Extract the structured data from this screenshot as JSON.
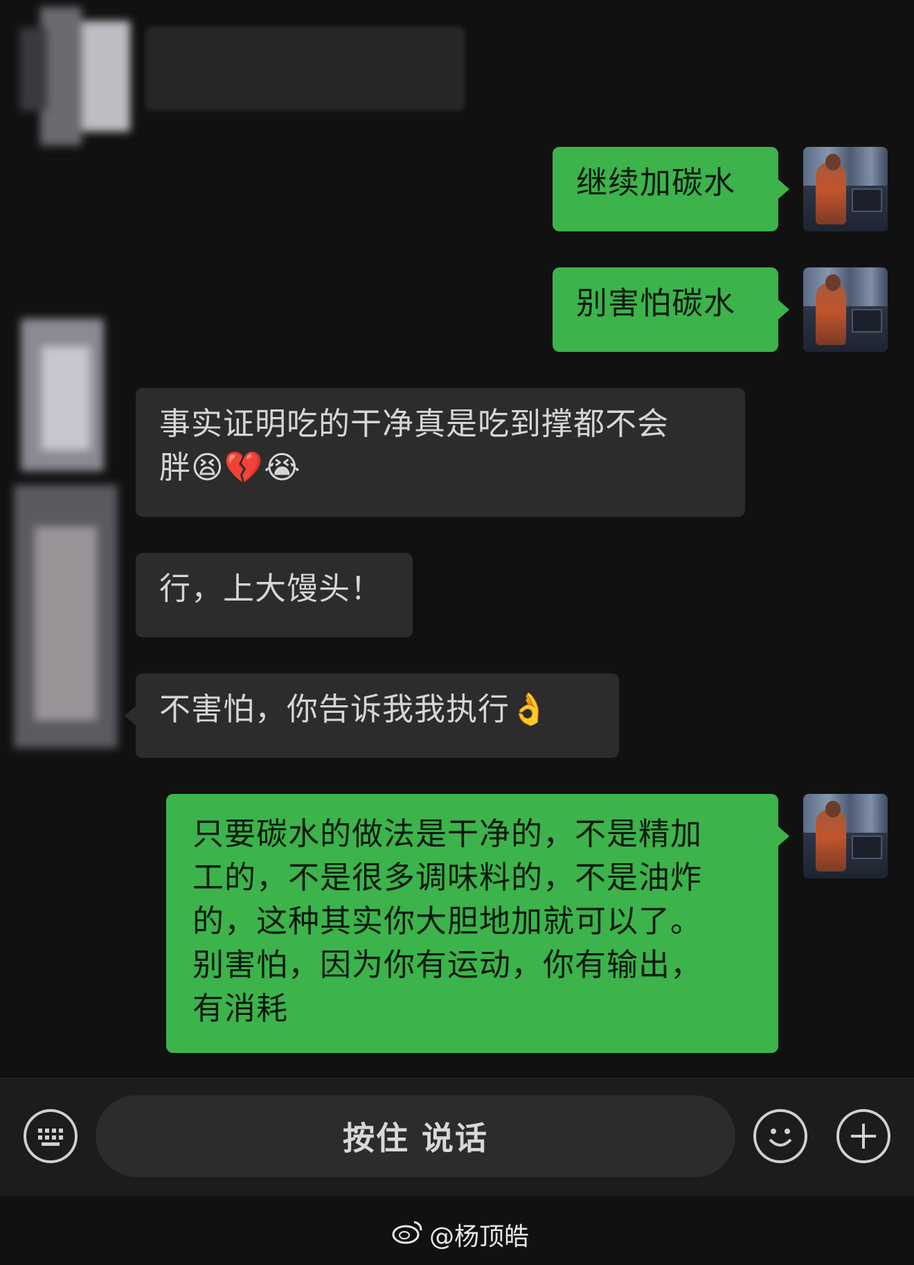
{
  "messages": [
    {
      "id": "m1",
      "side": "left",
      "text": "",
      "redacted": true
    },
    {
      "id": "m2",
      "side": "right",
      "text": "继续加碳水"
    },
    {
      "id": "m3",
      "side": "right",
      "text": "别害怕碳水"
    },
    {
      "id": "m4",
      "side": "left",
      "line1": "事实证明吃的干净真是吃到撑都不会",
      "line2": "胖😫💔😭"
    },
    {
      "id": "m5",
      "side": "left",
      "text": "行，上大馒头！"
    },
    {
      "id": "m6",
      "side": "left",
      "text": "不害怕，你告诉我我执行👌"
    },
    {
      "id": "m7",
      "side": "right",
      "lines": [
        "只要碳水的做法是干净的，不是精加",
        "工的，不是很多调味料的，不是油炸",
        "的，这种其实你大胆地加就可以了。",
        "别害怕，因为你有运动，你有输出，",
        "有消耗"
      ]
    }
  ],
  "input_bar": {
    "hold_to_talk": "按住 说话"
  },
  "icons": {
    "keyboard": "keyboard-icon",
    "emoji": "emoji-icon",
    "plus": "plus-icon"
  },
  "watermark": {
    "text": "@杨顶皓",
    "logo": "weibo-icon"
  },
  "colors": {
    "background": "#111111",
    "bubble_gray": "#2c2c2c",
    "bubble_green": "#3cb34b"
  }
}
